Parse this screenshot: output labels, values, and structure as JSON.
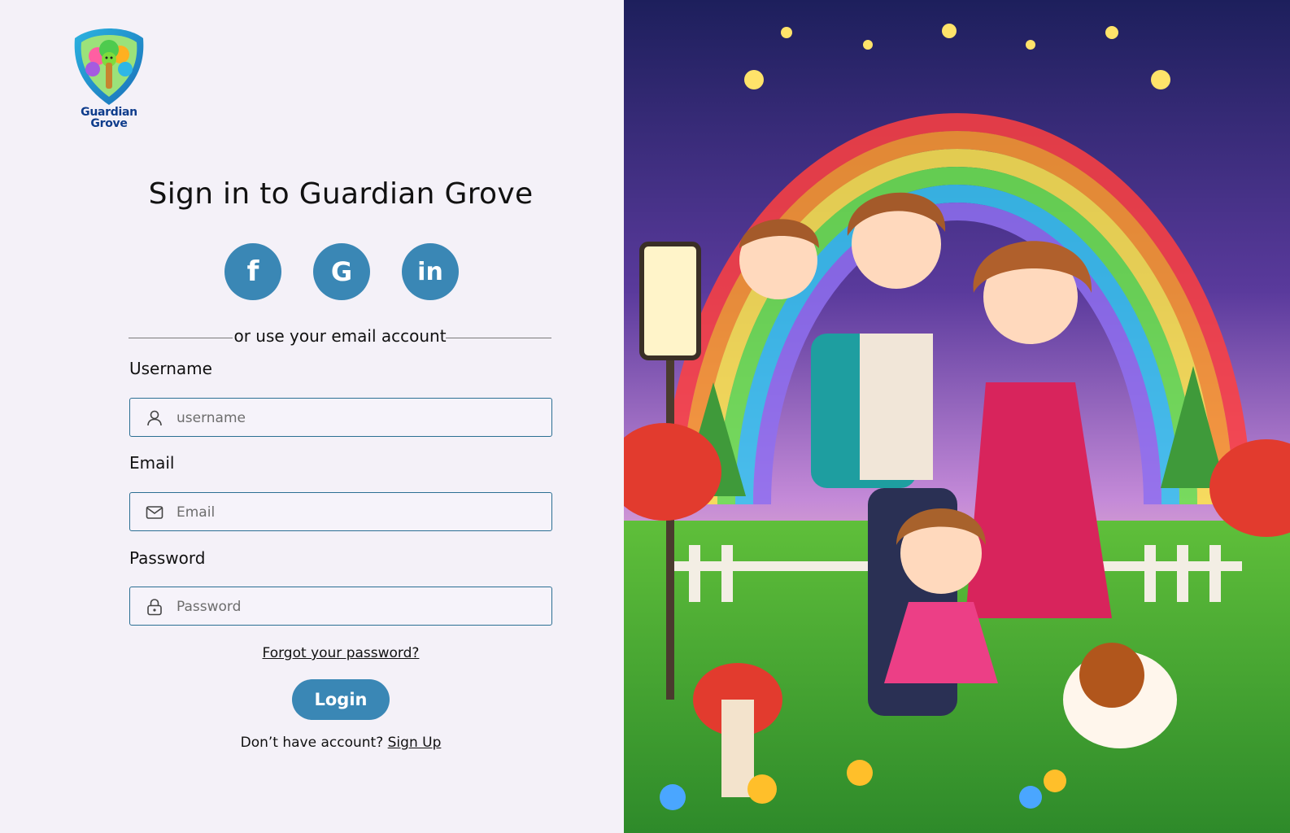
{
  "brand": {
    "logo_line1": "Guardian",
    "logo_line2": "Grove"
  },
  "title": "Sign in to Guardian Grove",
  "social": [
    {
      "name": "facebook",
      "glyph": "f"
    },
    {
      "name": "google",
      "glyph": "G"
    },
    {
      "name": "linkedin",
      "glyph": "in"
    }
  ],
  "divider_text": "or use your email account",
  "form": {
    "username_label": "Username",
    "username_placeholder": "username",
    "email_label": "Email",
    "email_placeholder": "Email",
    "password_label": "Password",
    "password_placeholder": "Password"
  },
  "forgot_text": "Forgot your password?",
  "login_label": "Login",
  "signup_prompt": "Don’t have account?",
  "signup_link": "Sign Up",
  "colors": {
    "accent": "#3a87b5",
    "field_border": "#2b6f93",
    "background": "#f4f1f8",
    "logo_text": "#0f3d8c"
  }
}
